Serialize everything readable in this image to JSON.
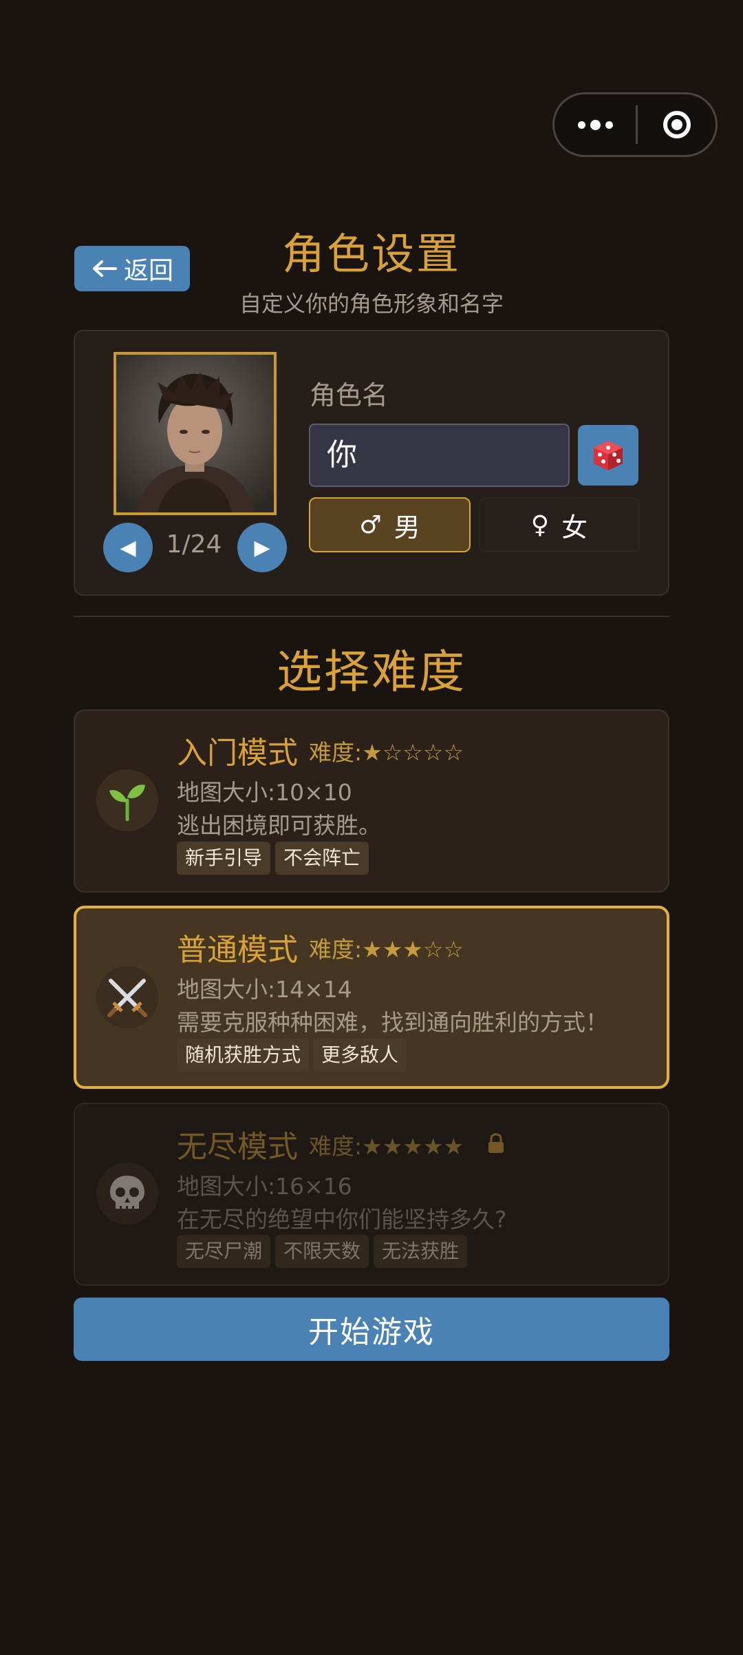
{
  "header": {
    "back_label": "返回",
    "title": "角色设置",
    "subtitle": "自定义你的角色形象和名字"
  },
  "profile": {
    "counter": "1/24",
    "name_label": "角色名",
    "name_value": "你",
    "gender_male": "男",
    "gender_female": "女",
    "gender_selected": "male"
  },
  "difficulty": {
    "section_title": "选择难度",
    "modes": [
      {
        "icon": "sprout-icon",
        "title": "入门模式",
        "difficulty": "难度:★☆☆☆☆",
        "map_size": "地图大小:10×10",
        "description": "逃出困境即可获胜。",
        "tags": [
          "新手引导",
          "不会阵亡"
        ],
        "selected": false,
        "locked": false
      },
      {
        "icon": "crossed-swords-icon",
        "title": "普通模式",
        "difficulty": "难度:★★★☆☆",
        "map_size": "地图大小:14×14",
        "description": "需要克服种种困难，找到通向胜利的方式！",
        "tags": [
          "随机获胜方式",
          "更多敌人"
        ],
        "selected": true,
        "locked": false
      },
      {
        "icon": "skull-icon",
        "title": "无尽模式",
        "difficulty": "难度:★★★★★",
        "map_size": "地图大小:16×16",
        "description": "在无尽的绝望中你们能坚持多久?",
        "tags": [
          "无尽尸潮",
          "不限天数",
          "无法获胜"
        ],
        "selected": false,
        "locked": true
      }
    ]
  },
  "start_label": "开始游戏",
  "colors": {
    "background": "#1a1411",
    "accent_gold": "#d9a238",
    "button_blue": "#4a82b6",
    "selected_border": "#e0b23a"
  }
}
